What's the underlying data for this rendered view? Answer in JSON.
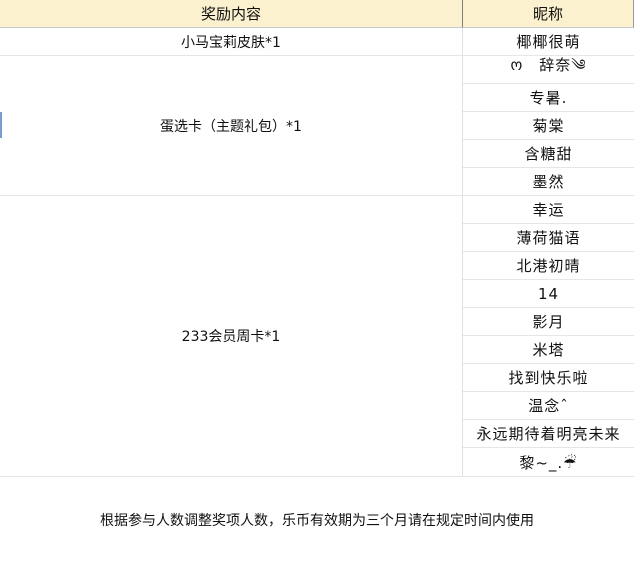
{
  "header": {
    "col_reward": "奖励内容",
    "col_nickname": "昵称"
  },
  "groups": [
    {
      "reward": "小马宝莉皮肤*1",
      "nicknames": [
        "椰椰很萌"
      ]
    },
    {
      "reward": "蛋选卡（主题礼包）*1",
      "nicknames": [
        "ო　辞奈༄",
        "专暑.",
        "菊棠",
        "含糖甜",
        "墨然"
      ]
    },
    {
      "reward": "233会员周卡*1",
      "nicknames": [
        "幸运",
        "薄荷猫语",
        "北港初晴",
        "14",
        "影月",
        "米塔",
        "找到快乐啦",
        "温念ˆ",
        "永远期待着明亮未来",
        "黎~_.☔"
      ]
    }
  ],
  "footer_note": "根据参与人数调整奖项人数，乐币有效期为三个月请在规定时间内使用"
}
